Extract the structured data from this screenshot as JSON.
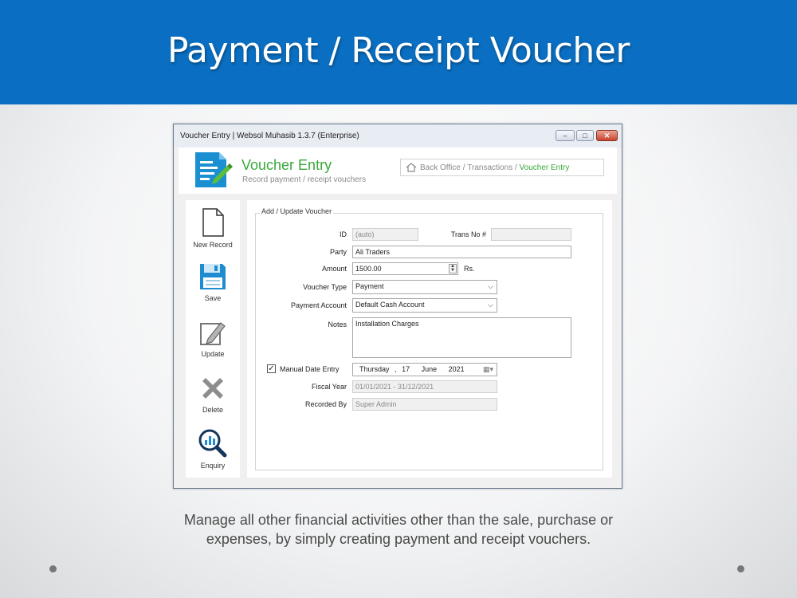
{
  "slide": {
    "title": "Payment / Receipt Voucher",
    "caption_line1": "Manage all other financial activities other than the sale, purchase or",
    "caption_line2": "expenses, by simply creating payment and receipt vouchers."
  },
  "window": {
    "title": "Voucher Entry | Websol Muhasib 1.3.7 (Enterprise)",
    "controls": {
      "minimize": "–",
      "maximize": "□",
      "close": "✕"
    }
  },
  "header": {
    "icon": "document-edit-icon",
    "title": "Voucher Entry",
    "subtitle": "Record payment / receipt vouchers",
    "breadcrumb": {
      "part1": "Back Office",
      "sep": " / ",
      "part2": "Transactions",
      "current": "Voucher Entry"
    }
  },
  "toolbar": {
    "new": "New Record",
    "save": "Save",
    "update": "Update",
    "delete": "Delete",
    "enquiry": "Enquiry"
  },
  "form": {
    "group_title": "Add / Update Voucher",
    "id_label": "ID",
    "id_value": "(auto)",
    "trans_no_label": "Trans No #",
    "trans_no_value": "",
    "party_label": "Party",
    "party_value": "Ali Traders",
    "amount_label": "Amount",
    "amount_value": "1500.00",
    "amount_unit": "Rs.",
    "voucher_type_label": "Voucher Type",
    "voucher_type_value": "Payment",
    "payment_account_label": "Payment Account",
    "payment_account_value": "Default Cash Account",
    "notes_label": "Notes",
    "notes_value": "Installation Charges",
    "manual_date_label": "Manual Date Entry",
    "manual_date_checked": true,
    "date_day_name": "Thursday",
    "date_sep": ",",
    "date_day": "17",
    "date_month": "June",
    "date_year": "2021",
    "fiscal_year_label": "Fiscal Year",
    "fiscal_year_value": "01/01/2021 - 31/12/2021",
    "recorded_by_label": "Recorded By",
    "recorded_by_value": "Super Admin"
  },
  "colors": {
    "banner": "#0a6fc2",
    "accent_green": "#3aa83a",
    "icon_blue": "#1a8fd1"
  }
}
